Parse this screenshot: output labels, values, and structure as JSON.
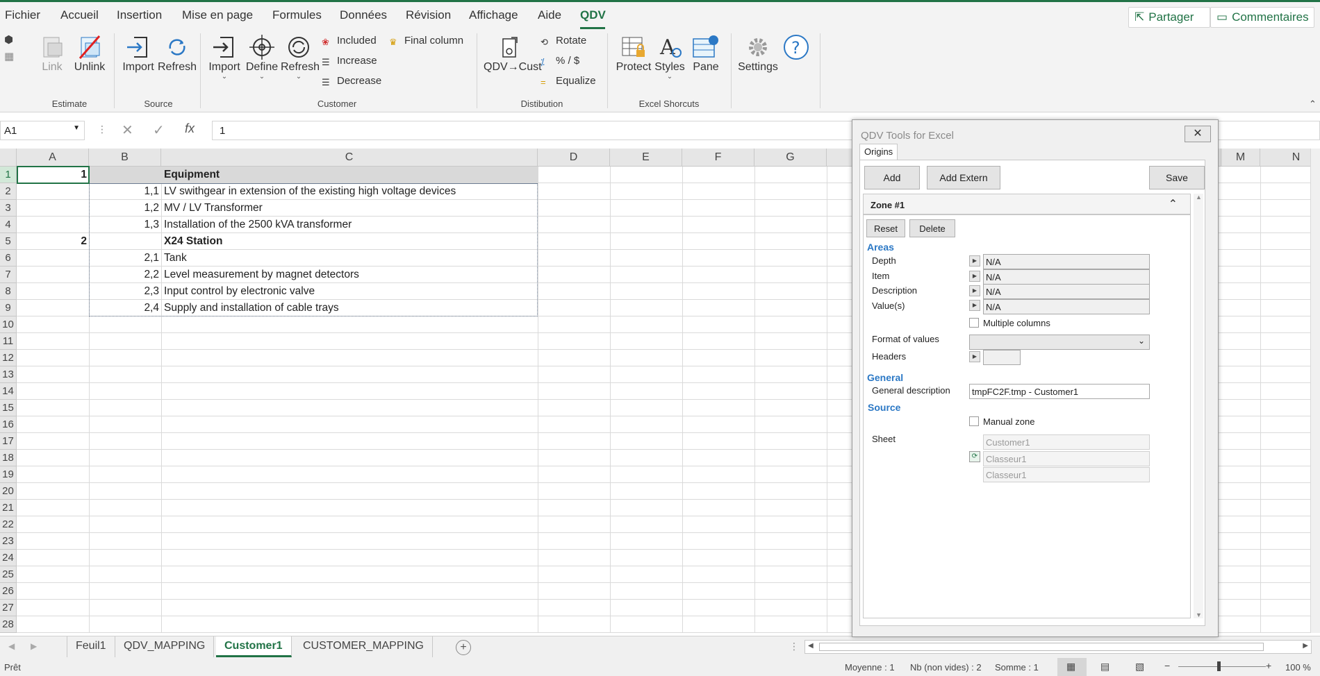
{
  "menu": {
    "items": [
      "Fichier",
      "Accueil",
      "Insertion",
      "Mise en page",
      "Formules",
      "Données",
      "Révision",
      "Affichage",
      "Aide",
      "QDV"
    ],
    "active": "QDV",
    "share_label": "Partager",
    "comments_label": "Commentaires"
  },
  "ribbon": {
    "estimate": {
      "label": "Estimate",
      "link": "Link",
      "unlink": "Unlink"
    },
    "source": {
      "label": "Source",
      "import": "Import",
      "refresh": "Refresh"
    },
    "customer": {
      "label": "Customer",
      "import": "Import",
      "define": "Define",
      "refresh": "Refresh",
      "included": "Included",
      "increase": "Increase",
      "decrease": "Decrease",
      "final_column": "Final column"
    },
    "distribution": {
      "label": "Distibution",
      "qdv_cust": "QDV→Cust",
      "rotate": "Rotate",
      "percent_dollar": "% / $",
      "equalize": "Equalize"
    },
    "shortcuts": {
      "label": "Excel Shorcuts",
      "protect": "Protect",
      "styles": "Styles",
      "pane": "Pane"
    },
    "settings": "Settings"
  },
  "formula_bar": {
    "name_box": "A1",
    "value": "1"
  },
  "grid": {
    "columns": [
      "A",
      "B",
      "C",
      "D",
      "E",
      "F",
      "G",
      "M",
      "N"
    ],
    "rows": [
      "1",
      "2",
      "3",
      "4",
      "5",
      "6",
      "7",
      "8",
      "9",
      "10",
      "11",
      "12",
      "13",
      "14",
      "15",
      "16",
      "17",
      "18",
      "19",
      "20",
      "21",
      "22",
      "23",
      "24",
      "25",
      "26",
      "27",
      "28"
    ],
    "data": [
      {
        "row": "1",
        "a": "1",
        "b": "",
        "c": "Equipment",
        "bold": true
      },
      {
        "row": "2",
        "a": "",
        "b": "1,1",
        "c": "LV swithgear in extension of the existing high voltage devices",
        "bold": false
      },
      {
        "row": "3",
        "a": "",
        "b": "1,2",
        "c": "MV / LV Transformer",
        "bold": false
      },
      {
        "row": "4",
        "a": "",
        "b": "1,3",
        "c": "Installation of the 2500 kVA transformer",
        "bold": false
      },
      {
        "row": "5",
        "a": "2",
        "b": "",
        "c": "X24 Station",
        "bold": true
      },
      {
        "row": "6",
        "a": "",
        "b": "2,1",
        "c": "Tank",
        "bold": false
      },
      {
        "row": "7",
        "a": "",
        "b": "2,2",
        "c": "Level measurement by magnet detectors",
        "bold": false
      },
      {
        "row": "8",
        "a": "",
        "b": "2,3",
        "c": "Input control by electronic valve",
        "bold": false
      },
      {
        "row": "9",
        "a": "",
        "b": "2,4",
        "c": "Supply and installation of cable trays",
        "bold": false
      }
    ]
  },
  "sheets": {
    "tabs": [
      "Feuil1",
      "QDV_MAPPING",
      "Customer1",
      "CUSTOMER_MAPPING"
    ],
    "active": "Customer1"
  },
  "status": {
    "ready": "Prêt",
    "average": "Moyenne : 1",
    "count": "Nb (non vides) : 2",
    "sum": "Somme : 1",
    "zoom": "100 %"
  },
  "pane": {
    "title": "QDV Tools for Excel",
    "tab": "Origins",
    "add": "Add",
    "add_extern": "Add Extern",
    "save": "Save",
    "zone_title": "Zone #1",
    "reset": "Reset",
    "delete": "Delete",
    "areas_title": "Areas",
    "depth_label": "Depth",
    "depth_value": "N/A",
    "item_label": "Item",
    "item_value": "N/A",
    "description_label": "Description",
    "description_value": "N/A",
    "values_label": "Value(s)",
    "values_value": "N/A",
    "multiple_columns": "Multiple columns",
    "format_label": "Format of values",
    "headers_label": "Headers",
    "general_title": "General",
    "general_desc_label": "General description",
    "general_desc_value": "tmpFC2F.tmp - Customer1",
    "source_title": "Source",
    "manual_zone": "Manual zone",
    "sheet_label": "Sheet",
    "sheet_value": "Customer1",
    "workbook_value_1": "Classeur1",
    "workbook_value_2": "Classeur1"
  },
  "colors": {
    "accent": "#217346",
    "pane_section": "#2b78c5"
  }
}
